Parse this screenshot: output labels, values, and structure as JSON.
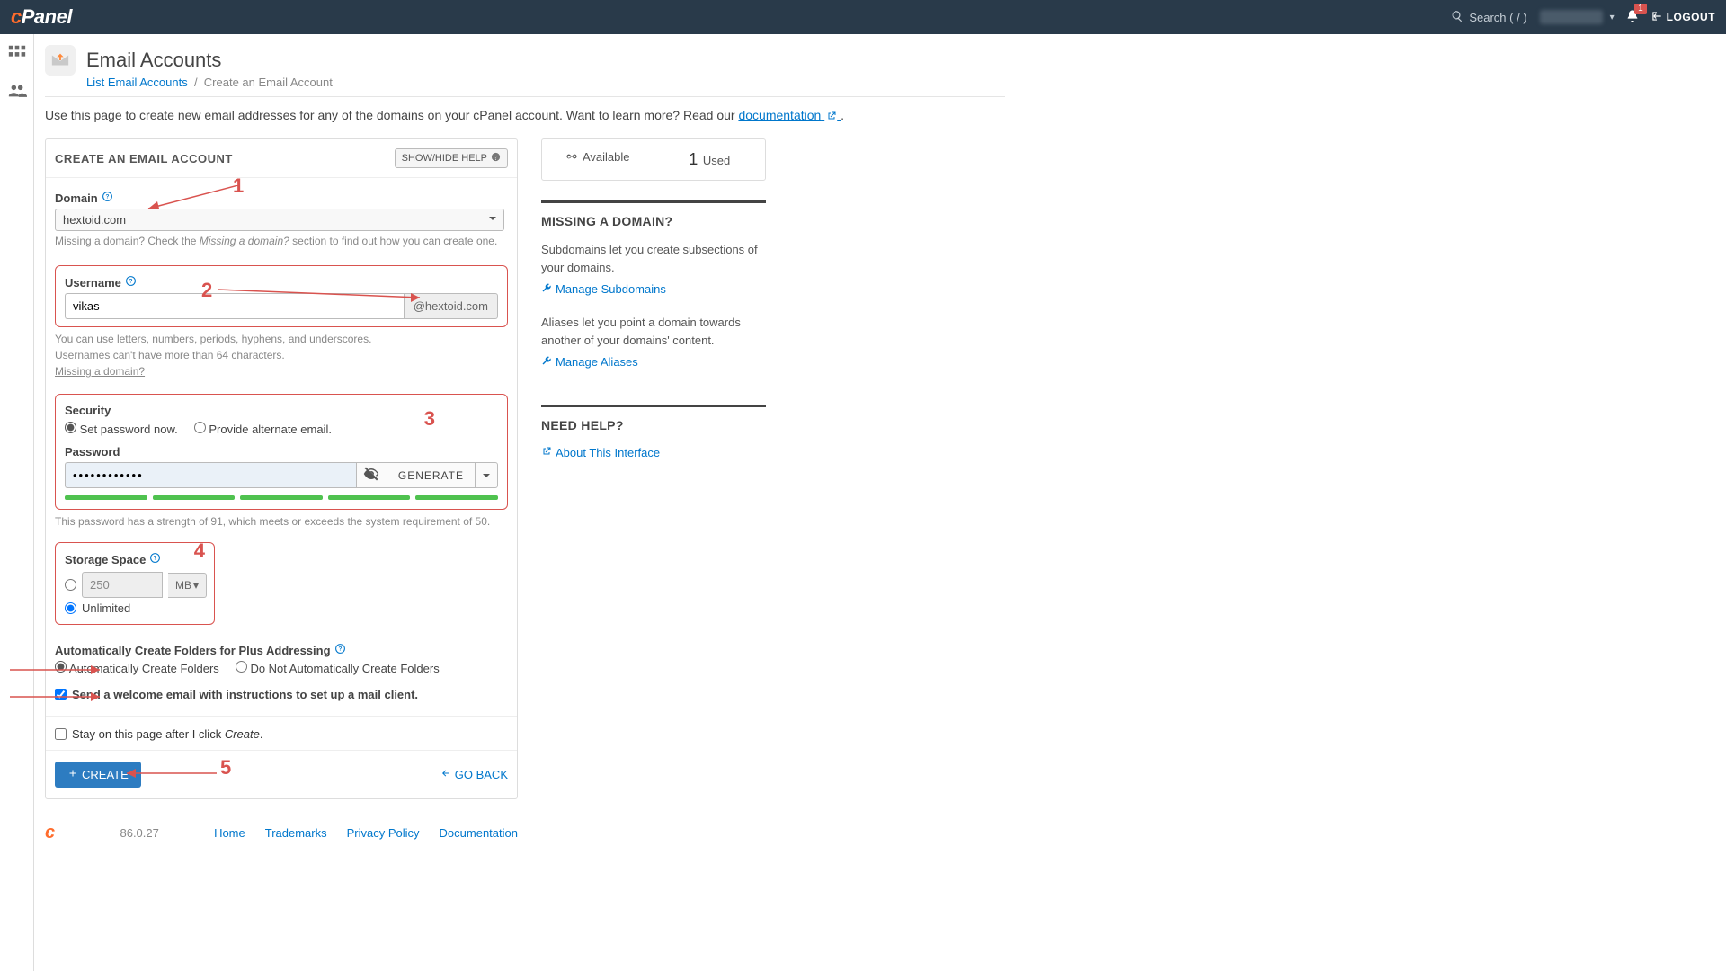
{
  "topbar": {
    "search_placeholder": "Search ( / )",
    "notification_count": "1",
    "logout": "LOGOUT"
  },
  "page": {
    "title": "Email Accounts",
    "crumb_list": "List Email Accounts",
    "crumb_current": "Create an Email Account",
    "intro_prefix": "Use this page to create new email addresses for any of the domains on your cPanel account. Want to learn more? Read our ",
    "intro_link": "documentation",
    "intro_suffix": " ."
  },
  "panel": {
    "title": "CREATE AN EMAIL ACCOUNT",
    "help_button": "SHOW/HIDE HELP"
  },
  "domain": {
    "label": "Domain",
    "value": "hextoid.com",
    "hint_prefix": "Missing a domain? Check the ",
    "hint_em": "Missing a domain?",
    "hint_suffix": " section to find out how you can create one."
  },
  "username": {
    "label": "Username",
    "value": "vikas",
    "suffix": "@hextoid.com",
    "hint1": "You can use letters, numbers, periods, hyphens, and underscores.",
    "hint2": "Usernames can't have more than 64 characters.",
    "hint_link": "Missing a domain?"
  },
  "security": {
    "label": "Security",
    "opt_now": "Set password now.",
    "opt_alt": "Provide alternate email.",
    "password_label": "Password",
    "password_value": "••••••••••••",
    "generate": "GENERATE",
    "strength_text": "This password has a strength of 91, which meets or exceeds the system requirement of 50."
  },
  "storage": {
    "label": "Storage Space",
    "quota_value": "250",
    "unit": "MB",
    "unlimited": "Unlimited"
  },
  "folders": {
    "label": "Automatically Create Folders for Plus Addressing",
    "opt_auto": "Automatically Create Folders",
    "opt_no": "Do Not Automatically Create Folders"
  },
  "welcome": {
    "label": "Send a welcome email with instructions to set up a mail client."
  },
  "stay": {
    "label_prefix": "Stay on this page after I click ",
    "label_em": "Create",
    "label_suffix": "."
  },
  "actions": {
    "create": "CREATE",
    "goback": "GO BACK"
  },
  "stats": {
    "available": "Available",
    "used_count": "1",
    "used": "Used"
  },
  "missing": {
    "title": "MISSING A DOMAIN?",
    "sub_text": "Subdomains let you create subsections of your domains.",
    "sub_link": "Manage Subdomains",
    "alias_text": "Aliases let you point a domain towards another of your domains' content.",
    "alias_link": "Manage Aliases"
  },
  "needhelp": {
    "title": "NEED HELP?",
    "about_link": "About This Interface"
  },
  "footer": {
    "version": "86.0.27",
    "home": "Home",
    "trademarks": "Trademarks",
    "privacy": "Privacy Policy",
    "documentation": "Documentation"
  },
  "annotations": {
    "n1": "1",
    "n2": "2",
    "n3": "3",
    "n4": "4",
    "n5": "5"
  }
}
